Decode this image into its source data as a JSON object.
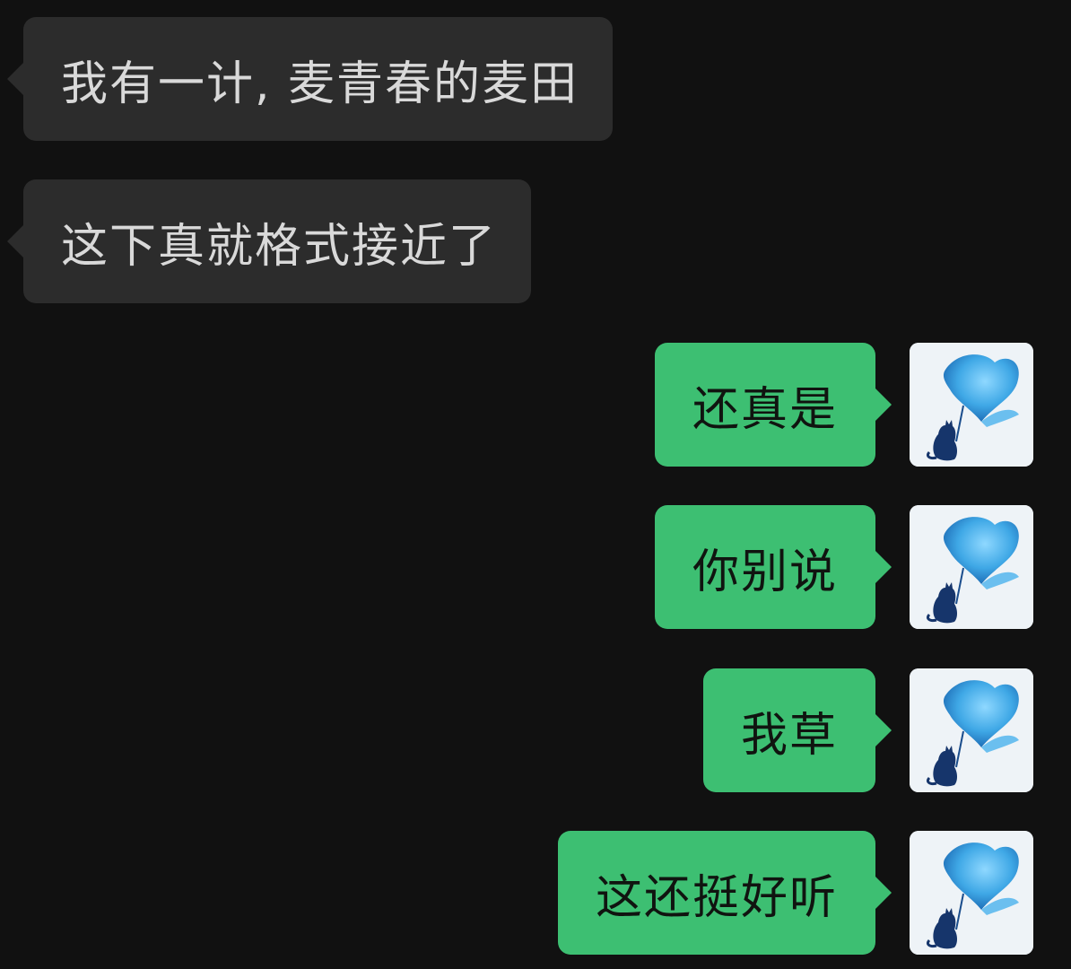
{
  "messages": [
    {
      "direction": "in",
      "text": "我有一计, 麦青春的麦田"
    },
    {
      "direction": "in",
      "text": "这下真就格式接近了"
    },
    {
      "direction": "out",
      "text": "还真是"
    },
    {
      "direction": "out",
      "text": "你别说"
    },
    {
      "direction": "out",
      "text": "我草"
    },
    {
      "direction": "out",
      "text": "这还挺好听"
    }
  ],
  "avatar": {
    "icon": "blue-heart-with-cat-silhouette-icon"
  },
  "colors": {
    "background": "#111111",
    "incoming_bubble": "#2c2c2c",
    "outgoing_bubble": "#3dbf72"
  }
}
